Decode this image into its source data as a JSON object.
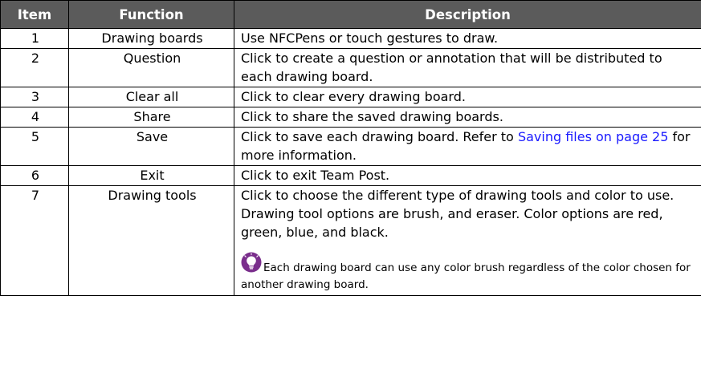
{
  "table": {
    "headers": [
      "Item",
      "Function",
      "Description"
    ],
    "rows": [
      {
        "item": "1",
        "function": "Drawing boards",
        "description": "Use NFCPens or touch gestures to draw."
      },
      {
        "item": "2",
        "function": "Question",
        "description": "Click to create a question or annotation that will be distributed to each drawing board."
      },
      {
        "item": "3",
        "function": "Clear all",
        "description": "Click to clear every drawing board."
      },
      {
        "item": "4",
        "function": "Share",
        "description": "Click to share the saved drawing boards."
      },
      {
        "item": "5",
        "function": "Save",
        "description_before": "Click to save each drawing board. Refer to ",
        "link": "Saving files on page 25",
        "description_after": " for more information."
      },
      {
        "item": "6",
        "function": "Exit",
        "description": "Click to exit Team Post."
      },
      {
        "item": "7",
        "function": "Drawing tools",
        "description": "Click to choose the different type of drawing tools and color to use. Drawing tool options are brush, and eraser. Color options are red, green, blue, and black.",
        "tip": "Each drawing board can use any color brush regardless of the color chosen for another drawing board."
      }
    ]
  },
  "colors": {
    "header_bg": "#5b5b5b",
    "header_text": "#ffffff",
    "link": "#1a1aff",
    "tip_icon": "#7a2e8c"
  },
  "icons": {
    "tip": "lightbulb-icon"
  }
}
